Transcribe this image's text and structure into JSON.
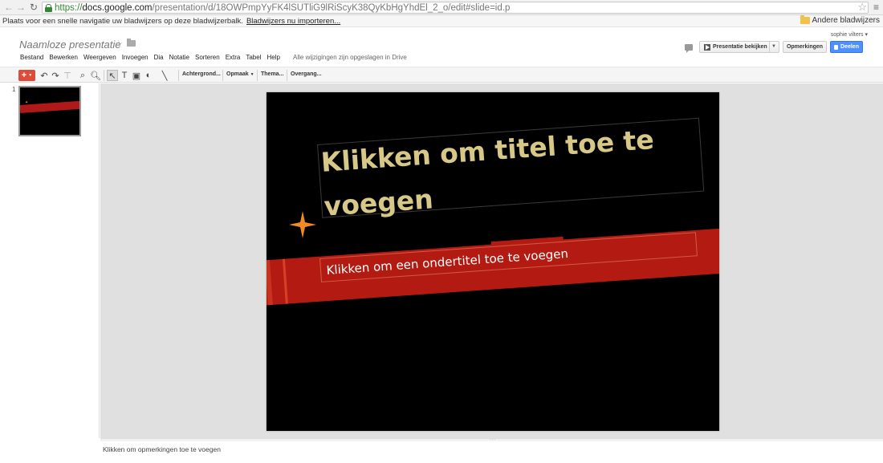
{
  "browser": {
    "url_scheme": "https://",
    "url_domain": "docs.google.com",
    "url_path": "/presentation/d/18OWPmpYyFK4lSUTliG9lRiScyK38QyKbHgYhdEl_2_o/edit#slide=id.p",
    "bookmarks_hint": "Plaats voor een snelle navigatie uw bladwijzers op deze bladwijzerbalk.",
    "bookmarks_import": "Bladwijzers nu importeren...",
    "other_bookmarks": "Andere bladwijzers"
  },
  "doc": {
    "title": "Naamloze presentatie",
    "save_status": "Alle wijzigingen zijn opgeslagen in Drive",
    "user": "sophie vilters ▾"
  },
  "menu": [
    "Bestand",
    "Bewerken",
    "Weergeven",
    "Invoegen",
    "Dia",
    "Notatie",
    "Sorteren",
    "Extra",
    "Tabel",
    "Help"
  ],
  "header_buttons": {
    "present": "Presentatie bekijken",
    "comments": "Opmerkingen",
    "share": "Deelen"
  },
  "toolbar": {
    "background": "Achtergrond...",
    "format": "Opmaak",
    "theme": "Thema...",
    "transition": "Overgang..."
  },
  "filmstrip": {
    "slide_number": "1"
  },
  "slide": {
    "title_placeholder": "Klikken om titel toe te voegen",
    "subtitle_placeholder": "Klikken om een ondertitel toe te voegen"
  },
  "notes": {
    "placeholder": "Klikken om opmerkingen toe te voegen"
  },
  "colors": {
    "title_text": "#d7c887",
    "band_red": "#b31b12",
    "star_orange": "#f08a24",
    "share_blue": "#4d90fe",
    "new_red": "#dd4b39"
  }
}
